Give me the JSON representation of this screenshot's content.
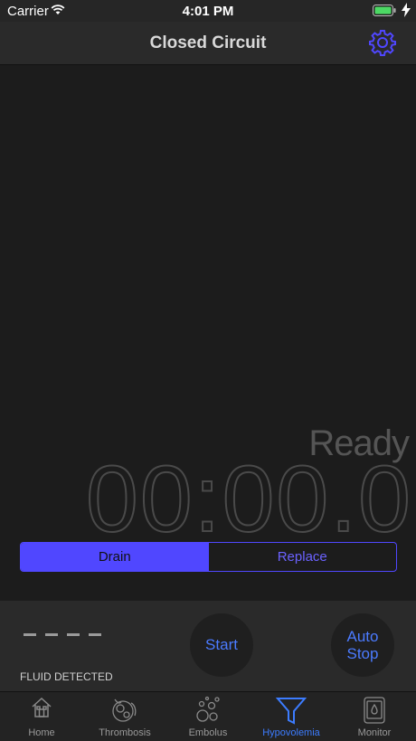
{
  "status_bar": {
    "carrier": "Carrier",
    "time": "4:01 PM"
  },
  "nav": {
    "title": "Closed Circuit",
    "settings_icon": "gear-icon"
  },
  "timer": {
    "state": "Ready",
    "display": "00:00.0"
  },
  "mode_toggle": {
    "options": [
      "Drain",
      "Replace"
    ],
    "selected": "Drain"
  },
  "controls": {
    "fluid_value": "- - - -",
    "fluid_label": "FLUID DETECTED",
    "start_label": "Start",
    "auto_stop_line1": "Auto",
    "auto_stop_line2": "Stop"
  },
  "tabs": [
    {
      "label": "Home",
      "icon": "home-icon"
    },
    {
      "label": "Thrombosis",
      "icon": "thrombosis-icon"
    },
    {
      "label": "Embolus",
      "icon": "bubbles-icon"
    },
    {
      "label": "Hypovolemia",
      "icon": "funnel-icon",
      "active": true
    },
    {
      "label": "Monitor",
      "icon": "monitor-icon"
    }
  ],
  "colors": {
    "accent": "#5047ff",
    "tab_active": "#3c7cff",
    "button_text": "#4b7bff"
  }
}
